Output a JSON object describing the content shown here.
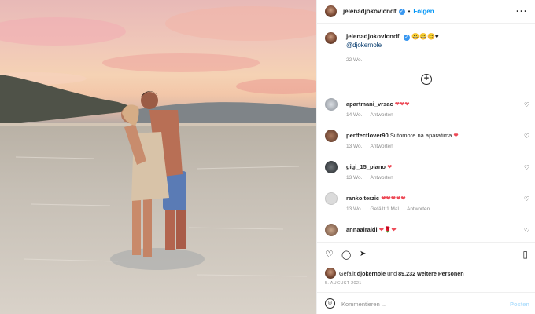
{
  "post": {
    "username": "jelenadjokovicndf",
    "verified_mark": "✓",
    "separator": "•",
    "follow_label": "Folgen",
    "more_label": "···"
  },
  "caption": {
    "username": "jelenadjokovicndf",
    "verified_mark": "✓",
    "emojis": "😀😄😊♥",
    "mention": "@djokernole",
    "time": "22 Wo."
  },
  "add_button": "+",
  "comments": [
    {
      "username": "apartmani_vrsac",
      "text": "",
      "hearts": "❤❤❤",
      "time": "14 Wo.",
      "reply": "Antworten",
      "likes": ""
    },
    {
      "username": "perffectlover90",
      "text": "Sutomore na aparatima",
      "hearts": "❤",
      "time": "13 Wo.",
      "reply": "Antworten",
      "likes": ""
    },
    {
      "username": "gigi_15_piano",
      "text": "",
      "hearts": "❤",
      "time": "13 Wo.",
      "reply": "Antworten",
      "likes": ""
    },
    {
      "username": "ranko.terzic",
      "text": "",
      "hearts": "❤❤❤❤❤",
      "time": "13 Wo.",
      "reply": "Antworten",
      "likes": "Gefällt 1 Mal"
    },
    {
      "username": "annaairaldi",
      "text": "",
      "hearts": "❤🌹❤",
      "time": "",
      "reply": "",
      "likes": ""
    }
  ],
  "comment_like_icon": "♡",
  "actions": {
    "like_icon": "♡",
    "comment_icon": "◯",
    "share_icon": "➤",
    "save_icon": "▯"
  },
  "likes": {
    "prefix": "Gefällt",
    "user": "djokernole",
    "middle": "und",
    "count": "89.232 weitere Personen"
  },
  "date": "5. AUGUST 2021",
  "add_comment": {
    "emoji_icon": "☺",
    "placeholder": "Kommentieren ...",
    "post_label": "Posten"
  }
}
